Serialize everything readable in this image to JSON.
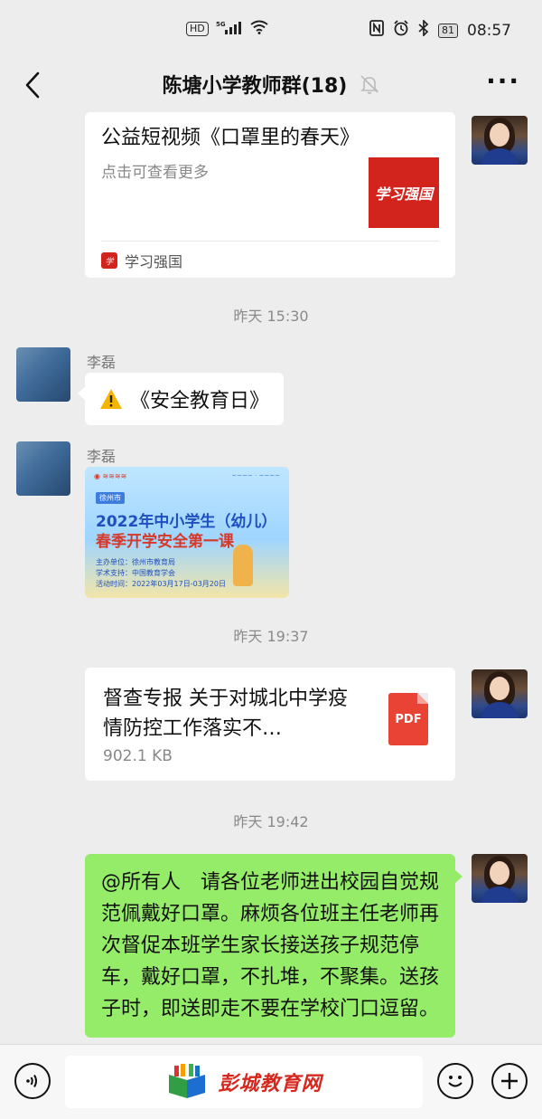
{
  "status_bar": {
    "network_left": "HD",
    "signal_label": "5G",
    "battery": "81",
    "time": "08:57"
  },
  "nav": {
    "title": "陈塘小学教师群(18)"
  },
  "messages": {
    "link_card": {
      "title": "公益短视频《口罩里的春天》",
      "desc": "点击可查看更多",
      "thumb_text": "学习强国",
      "source": "学习强国"
    },
    "time1": "昨天 15:30",
    "msg1": {
      "sender": "李磊",
      "text": "《安全教育日》"
    },
    "msg2": {
      "sender": "李磊",
      "image_tag": "徐州市",
      "image_line1": "2022年中小学生（幼儿）",
      "image_line2": "春季开学安全第一课",
      "image_line3": "主办单位：徐州市教育局",
      "image_line4": "学术支持：中国教育学会",
      "image_line5": "活动时间：2022年03月17日-03月20日"
    },
    "time2": "昨天 19:37",
    "file": {
      "name": "督查专报 关于对城北中学疫情防控工作落实不…",
      "size": "902.1 KB",
      "type": "PDF"
    },
    "time3": "昨天 19:42",
    "text_msg": "@所有人　请各位老师进出校园自觉规范佩戴好口罩。麻烦各位班主任老师再次督促本班学生家长接送孩子规范停车，戴好口罩，不扎堆，不聚集。送孩子时，即送即走不要在学校门口逗留。"
  },
  "input_bar": {
    "watermark": "彭城教育网"
  },
  "colors": {
    "chat_bg": "#ededed",
    "green_bubble": "#95ec69",
    "brand_red": "#d2231c"
  }
}
